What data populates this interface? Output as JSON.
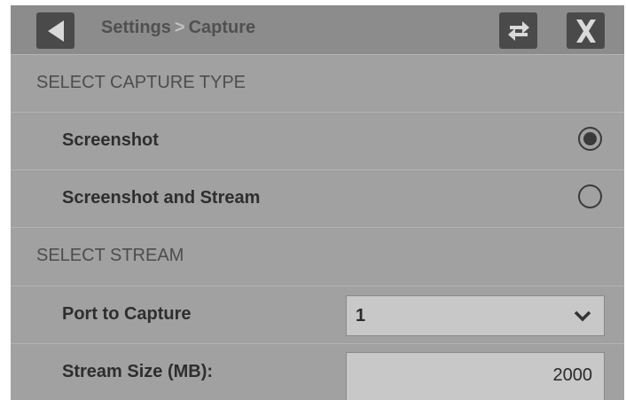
{
  "header": {
    "breadcrumb_parent": "Settings",
    "breadcrumb_separator": ">",
    "breadcrumb_current": "Capture",
    "back_icon": "back-triangle-icon",
    "swap_icon": "swap-arrows-icon",
    "close_icon": "close-x-icon"
  },
  "capture_type": {
    "section_label": "SELECT CAPTURE TYPE",
    "options": [
      {
        "label": "Screenshot",
        "selected": true
      },
      {
        "label": "Screenshot and Stream",
        "selected": false
      }
    ]
  },
  "stream": {
    "section_label": "SELECT STREAM",
    "port_label": "Port to Capture",
    "port_value": "1",
    "size_label": "Stream Size (MB):",
    "size_value": "2000"
  }
}
